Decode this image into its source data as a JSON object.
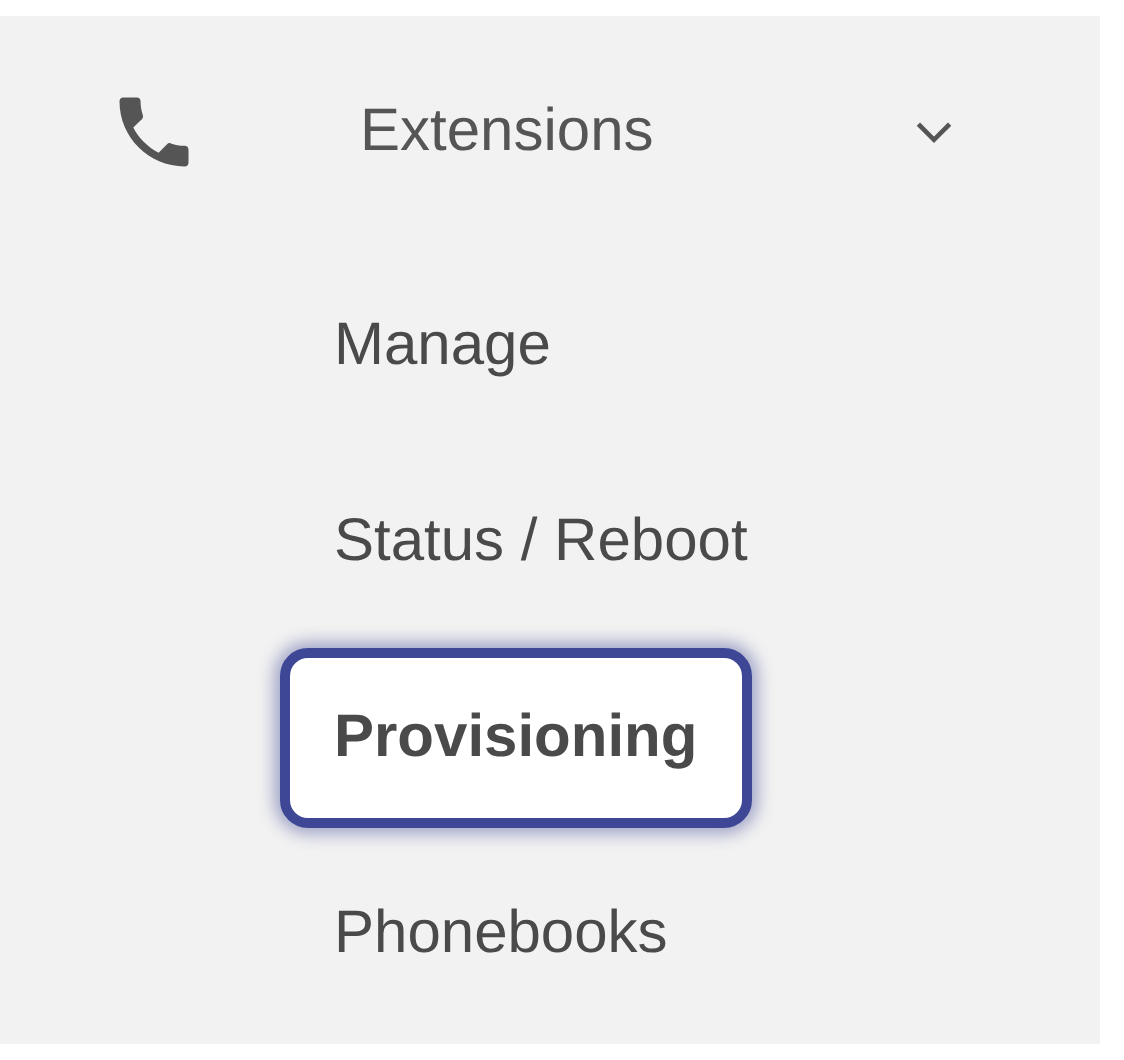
{
  "menu": {
    "label": "Extensions",
    "expanded": true,
    "items": [
      {
        "label": "Manage",
        "selected": false
      },
      {
        "label": "Status / Reboot",
        "selected": false
      },
      {
        "label": "Provisioning",
        "selected": true
      },
      {
        "label": "Phonebooks",
        "selected": false
      }
    ]
  }
}
